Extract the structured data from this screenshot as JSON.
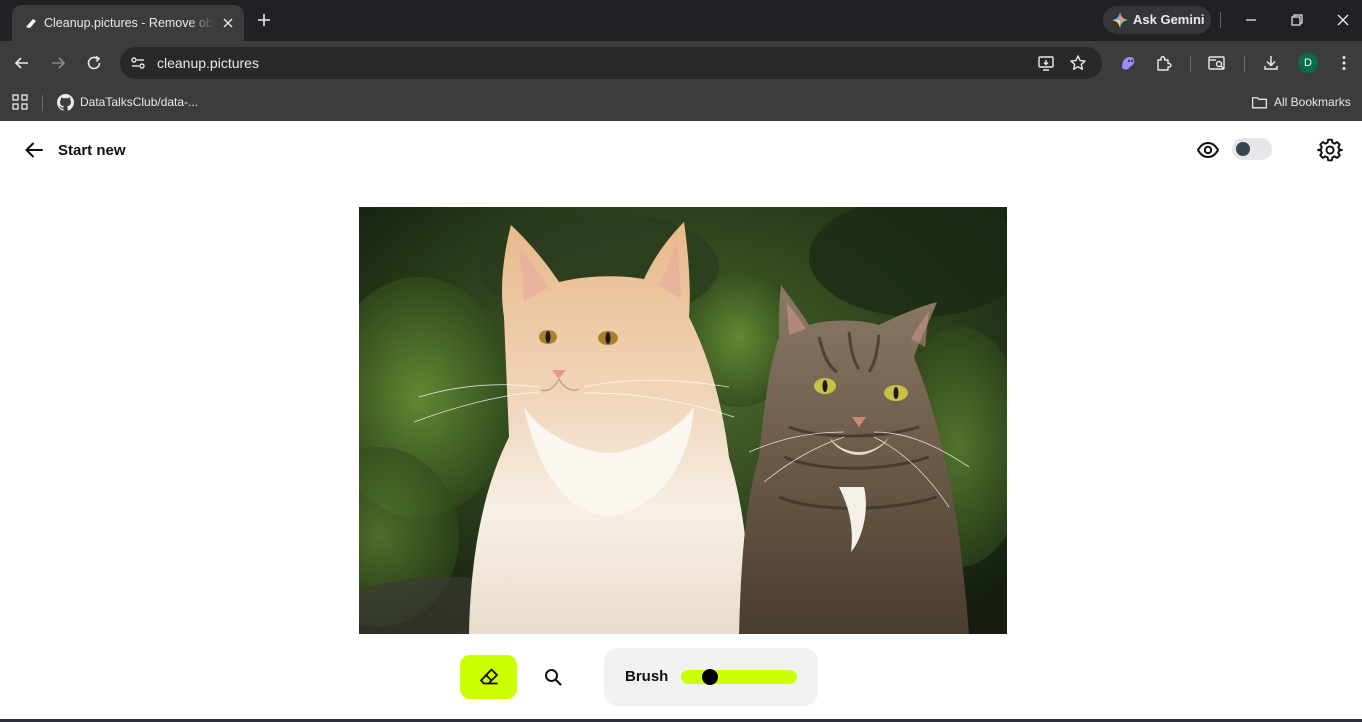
{
  "browser": {
    "tab": {
      "title": "Cleanup.pictures - Remove objects, people, text and defects from any picture",
      "favicon": "cleanup-logo-icon"
    },
    "gemini_label": "Ask Gemini",
    "address": {
      "url": "cleanup.pictures"
    },
    "profile_initial": "D",
    "bookmarks": [
      {
        "label": "DataTalksClub/data-...",
        "icon": "github-icon"
      }
    ],
    "all_bookmarks_label": "All Bookmarks"
  },
  "app": {
    "start_new_label": "Start new",
    "brush_label": "Brush",
    "brush_size_fraction": 0.25,
    "accent_color": "#ccff00",
    "compare_toggle_on": false
  }
}
